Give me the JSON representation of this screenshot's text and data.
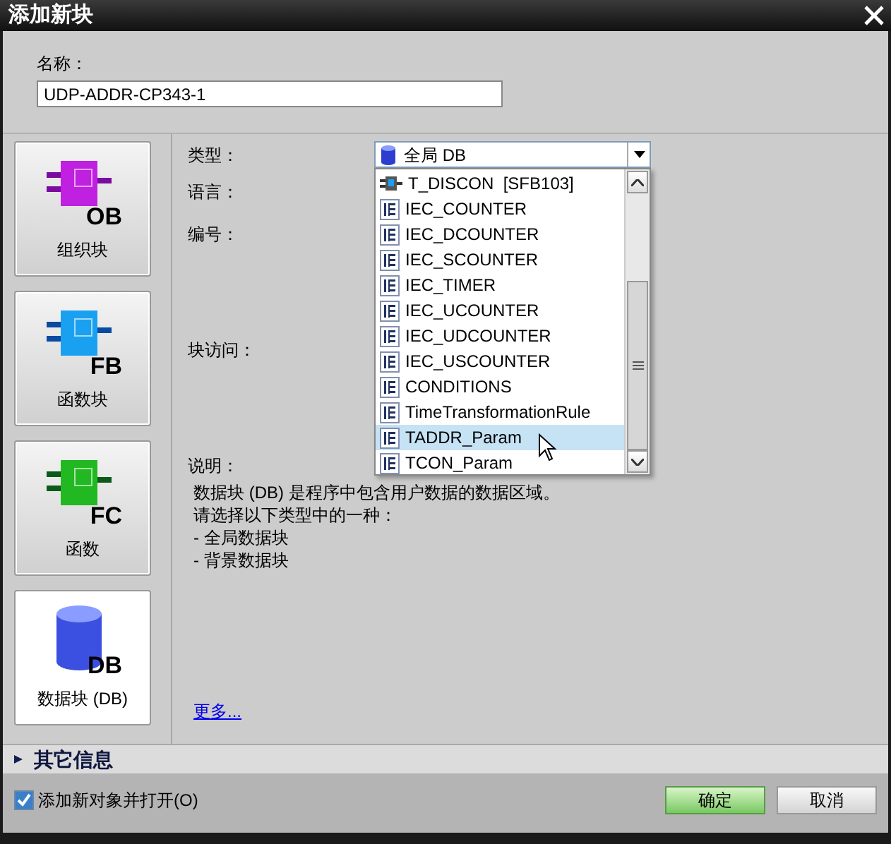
{
  "window": {
    "title": "添加新块"
  },
  "name_field": {
    "label": "名称：",
    "value": "UDP-ADDR-CP343-1"
  },
  "block_types": [
    {
      "kind": "ob",
      "badge": "OB",
      "label": "组织块",
      "selected": false
    },
    {
      "kind": "fb",
      "badge": "FB",
      "label": "函数块",
      "selected": false
    },
    {
      "kind": "fc",
      "badge": "FC",
      "label": "函数",
      "selected": false
    },
    {
      "kind": "db",
      "badge": "DB",
      "label": "数据块 (DB)",
      "selected": true
    }
  ],
  "fields": [
    {
      "label": "类型："
    },
    {
      "label": "语言："
    },
    {
      "label": "编号："
    },
    {
      "label": "块访问："
    }
  ],
  "type_dropdown": {
    "value": "全局 DB",
    "options": [
      {
        "kind": "fb",
        "label": "T_DISCON  [SFB103]",
        "selected": false
      },
      {
        "kind": "type",
        "label": "IEC_COUNTER",
        "selected": false
      },
      {
        "kind": "type",
        "label": "IEC_DCOUNTER",
        "selected": false
      },
      {
        "kind": "type",
        "label": "IEC_SCOUNTER",
        "selected": false
      },
      {
        "kind": "type",
        "label": "IEC_TIMER",
        "selected": false
      },
      {
        "kind": "type",
        "label": "IEC_UCOUNTER",
        "selected": false
      },
      {
        "kind": "type",
        "label": "IEC_UDCOUNTER",
        "selected": false
      },
      {
        "kind": "type",
        "label": "IEC_USCOUNTER",
        "selected": false
      },
      {
        "kind": "type",
        "label": "CONDITIONS",
        "selected": false
      },
      {
        "kind": "type",
        "label": "TimeTransformationRule",
        "selected": false
      },
      {
        "kind": "type",
        "label": "TADDR_Param",
        "selected": true
      },
      {
        "kind": "type",
        "label": "TCON_Param",
        "selected": false
      }
    ]
  },
  "description": {
    "label": "说明：",
    "lines": [
      "数据块 (DB) 是程序中包含用户数据的数据区域。",
      "请选择以下类型中的一种：",
      "-  全局数据块",
      "-  背景数据块"
    ],
    "more_link": "更多..."
  },
  "more_info": {
    "label": "其它信息",
    "expanded": false
  },
  "open_after_add": {
    "label": "添加新对象并打开(O)",
    "checked": true
  },
  "buttons": [
    {
      "kind": "primary",
      "label": "确定"
    },
    {
      "kind": "secondary",
      "label": "取消"
    }
  ]
}
